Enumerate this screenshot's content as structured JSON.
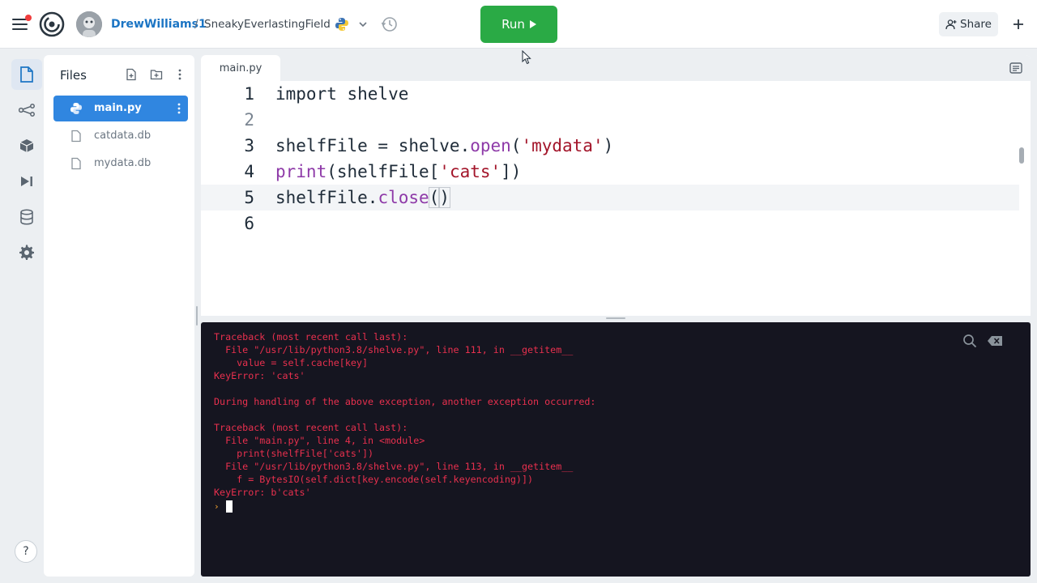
{
  "header": {
    "username": "DrewWilliams1",
    "separator": "/",
    "repl_name": "SneakyEverlastingField",
    "run_label": "Run",
    "share_label": "Share"
  },
  "files_panel": {
    "title": "Files",
    "files": [
      {
        "name": "main.py",
        "active": true
      },
      {
        "name": "catdata.db",
        "active": false
      },
      {
        "name": "mydata.db",
        "active": false
      }
    ]
  },
  "editor": {
    "active_tab": "main.py",
    "current_line": 5,
    "lines": [
      {
        "number": "1",
        "code": "import shelve"
      },
      {
        "number": "2",
        "code": ""
      },
      {
        "number": "3",
        "code": "shelfFile = shelve.open('mydata')"
      },
      {
        "number": "4",
        "code": "print(shelfFile['cats'])"
      },
      {
        "number": "5",
        "code": "shelfFile.close()"
      },
      {
        "number": "6",
        "code": ""
      }
    ]
  },
  "console": {
    "output": "Traceback (most recent call last):\n  File \"/usr/lib/python3.8/shelve.py\", line 111, in __getitem__\n    value = self.cache[key]\nKeyError: 'cats'\n\nDuring handling of the above exception, another exception occurred:\n\nTraceback (most recent call last):\n  File \"main.py\", line 4, in <module>\n    print(shelfFile['cats'])\n  File \"/usr/lib/python3.8/shelve.py\", line 113, in __getitem__\n    f = BytesIO(self.dict[key.encode(self.keyencoding)])\nKeyError: b'cats'",
    "prompt_symbol": "›"
  },
  "help_label": "?",
  "colors": {
    "run_green": "#2aaa45",
    "active_file_blue": "#3086e0",
    "link_blue": "#1c75c4",
    "console_bg": "#151520",
    "console_error": "#e8304e"
  }
}
